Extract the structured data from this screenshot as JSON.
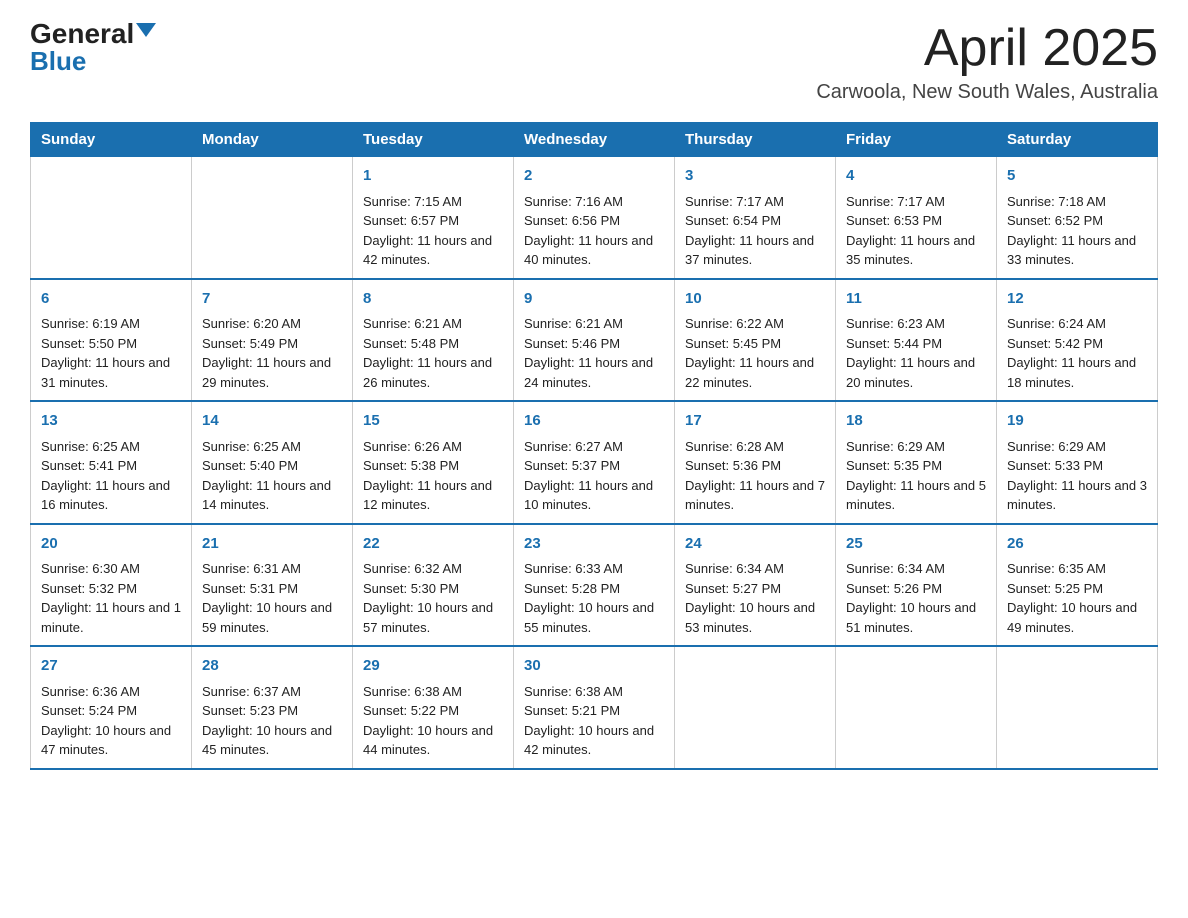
{
  "header": {
    "logo_general": "General",
    "logo_blue": "Blue",
    "title": "April 2025",
    "subtitle": "Carwoola, New South Wales, Australia"
  },
  "days_of_week": [
    "Sunday",
    "Monday",
    "Tuesday",
    "Wednesday",
    "Thursday",
    "Friday",
    "Saturday"
  ],
  "weeks": [
    [
      {
        "day": "",
        "sunrise": "",
        "sunset": "",
        "daylight": ""
      },
      {
        "day": "",
        "sunrise": "",
        "sunset": "",
        "daylight": ""
      },
      {
        "day": "1",
        "sunrise": "Sunrise: 7:15 AM",
        "sunset": "Sunset: 6:57 PM",
        "daylight": "Daylight: 11 hours and 42 minutes."
      },
      {
        "day": "2",
        "sunrise": "Sunrise: 7:16 AM",
        "sunset": "Sunset: 6:56 PM",
        "daylight": "Daylight: 11 hours and 40 minutes."
      },
      {
        "day": "3",
        "sunrise": "Sunrise: 7:17 AM",
        "sunset": "Sunset: 6:54 PM",
        "daylight": "Daylight: 11 hours and 37 minutes."
      },
      {
        "day": "4",
        "sunrise": "Sunrise: 7:17 AM",
        "sunset": "Sunset: 6:53 PM",
        "daylight": "Daylight: 11 hours and 35 minutes."
      },
      {
        "day": "5",
        "sunrise": "Sunrise: 7:18 AM",
        "sunset": "Sunset: 6:52 PM",
        "daylight": "Daylight: 11 hours and 33 minutes."
      }
    ],
    [
      {
        "day": "6",
        "sunrise": "Sunrise: 6:19 AM",
        "sunset": "Sunset: 5:50 PM",
        "daylight": "Daylight: 11 hours and 31 minutes."
      },
      {
        "day": "7",
        "sunrise": "Sunrise: 6:20 AM",
        "sunset": "Sunset: 5:49 PM",
        "daylight": "Daylight: 11 hours and 29 minutes."
      },
      {
        "day": "8",
        "sunrise": "Sunrise: 6:21 AM",
        "sunset": "Sunset: 5:48 PM",
        "daylight": "Daylight: 11 hours and 26 minutes."
      },
      {
        "day": "9",
        "sunrise": "Sunrise: 6:21 AM",
        "sunset": "Sunset: 5:46 PM",
        "daylight": "Daylight: 11 hours and 24 minutes."
      },
      {
        "day": "10",
        "sunrise": "Sunrise: 6:22 AM",
        "sunset": "Sunset: 5:45 PM",
        "daylight": "Daylight: 11 hours and 22 minutes."
      },
      {
        "day": "11",
        "sunrise": "Sunrise: 6:23 AM",
        "sunset": "Sunset: 5:44 PM",
        "daylight": "Daylight: 11 hours and 20 minutes."
      },
      {
        "day": "12",
        "sunrise": "Sunrise: 6:24 AM",
        "sunset": "Sunset: 5:42 PM",
        "daylight": "Daylight: 11 hours and 18 minutes."
      }
    ],
    [
      {
        "day": "13",
        "sunrise": "Sunrise: 6:25 AM",
        "sunset": "Sunset: 5:41 PM",
        "daylight": "Daylight: 11 hours and 16 minutes."
      },
      {
        "day": "14",
        "sunrise": "Sunrise: 6:25 AM",
        "sunset": "Sunset: 5:40 PM",
        "daylight": "Daylight: 11 hours and 14 minutes."
      },
      {
        "day": "15",
        "sunrise": "Sunrise: 6:26 AM",
        "sunset": "Sunset: 5:38 PM",
        "daylight": "Daylight: 11 hours and 12 minutes."
      },
      {
        "day": "16",
        "sunrise": "Sunrise: 6:27 AM",
        "sunset": "Sunset: 5:37 PM",
        "daylight": "Daylight: 11 hours and 10 minutes."
      },
      {
        "day": "17",
        "sunrise": "Sunrise: 6:28 AM",
        "sunset": "Sunset: 5:36 PM",
        "daylight": "Daylight: 11 hours and 7 minutes."
      },
      {
        "day": "18",
        "sunrise": "Sunrise: 6:29 AM",
        "sunset": "Sunset: 5:35 PM",
        "daylight": "Daylight: 11 hours and 5 minutes."
      },
      {
        "day": "19",
        "sunrise": "Sunrise: 6:29 AM",
        "sunset": "Sunset: 5:33 PM",
        "daylight": "Daylight: 11 hours and 3 minutes."
      }
    ],
    [
      {
        "day": "20",
        "sunrise": "Sunrise: 6:30 AM",
        "sunset": "Sunset: 5:32 PM",
        "daylight": "Daylight: 11 hours and 1 minute."
      },
      {
        "day": "21",
        "sunrise": "Sunrise: 6:31 AM",
        "sunset": "Sunset: 5:31 PM",
        "daylight": "Daylight: 10 hours and 59 minutes."
      },
      {
        "day": "22",
        "sunrise": "Sunrise: 6:32 AM",
        "sunset": "Sunset: 5:30 PM",
        "daylight": "Daylight: 10 hours and 57 minutes."
      },
      {
        "day": "23",
        "sunrise": "Sunrise: 6:33 AM",
        "sunset": "Sunset: 5:28 PM",
        "daylight": "Daylight: 10 hours and 55 minutes."
      },
      {
        "day": "24",
        "sunrise": "Sunrise: 6:34 AM",
        "sunset": "Sunset: 5:27 PM",
        "daylight": "Daylight: 10 hours and 53 minutes."
      },
      {
        "day": "25",
        "sunrise": "Sunrise: 6:34 AM",
        "sunset": "Sunset: 5:26 PM",
        "daylight": "Daylight: 10 hours and 51 minutes."
      },
      {
        "day": "26",
        "sunrise": "Sunrise: 6:35 AM",
        "sunset": "Sunset: 5:25 PM",
        "daylight": "Daylight: 10 hours and 49 minutes."
      }
    ],
    [
      {
        "day": "27",
        "sunrise": "Sunrise: 6:36 AM",
        "sunset": "Sunset: 5:24 PM",
        "daylight": "Daylight: 10 hours and 47 minutes."
      },
      {
        "day": "28",
        "sunrise": "Sunrise: 6:37 AM",
        "sunset": "Sunset: 5:23 PM",
        "daylight": "Daylight: 10 hours and 45 minutes."
      },
      {
        "day": "29",
        "sunrise": "Sunrise: 6:38 AM",
        "sunset": "Sunset: 5:22 PM",
        "daylight": "Daylight: 10 hours and 44 minutes."
      },
      {
        "day": "30",
        "sunrise": "Sunrise: 6:38 AM",
        "sunset": "Sunset: 5:21 PM",
        "daylight": "Daylight: 10 hours and 42 minutes."
      },
      {
        "day": "",
        "sunrise": "",
        "sunset": "",
        "daylight": ""
      },
      {
        "day": "",
        "sunrise": "",
        "sunset": "",
        "daylight": ""
      },
      {
        "day": "",
        "sunrise": "",
        "sunset": "",
        "daylight": ""
      }
    ]
  ]
}
